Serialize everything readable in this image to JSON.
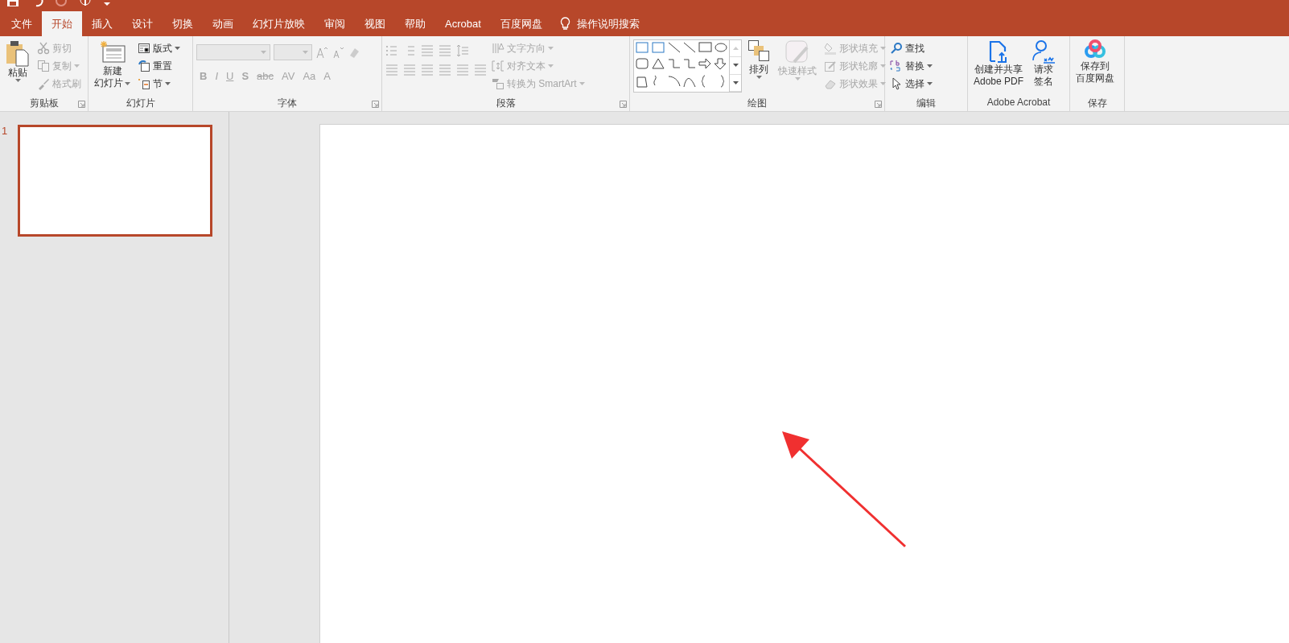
{
  "tabs": [
    {
      "label": "文件",
      "selected": false
    },
    {
      "label": "开始",
      "selected": true
    },
    {
      "label": "插入",
      "selected": false
    },
    {
      "label": "设计",
      "selected": false
    },
    {
      "label": "切换",
      "selected": false
    },
    {
      "label": "动画",
      "selected": false
    },
    {
      "label": "幻灯片放映",
      "selected": false
    },
    {
      "label": "审阅",
      "selected": false
    },
    {
      "label": "视图",
      "selected": false
    },
    {
      "label": "帮助",
      "selected": false
    },
    {
      "label": "Acrobat",
      "selected": false
    },
    {
      "label": "百度网盘",
      "selected": false
    }
  ],
  "tell_me": {
    "label": "操作说明搜索"
  },
  "ribbon": {
    "clipboard": {
      "label": "剪贴板",
      "paste": {
        "label": "粘贴"
      },
      "items": [
        {
          "label": "剪切",
          "disabled": true,
          "dropdown": false
        },
        {
          "label": "复制",
          "disabled": true,
          "dropdown": true
        },
        {
          "label": "格式刷",
          "disabled": true,
          "dropdown": false
        }
      ]
    },
    "slides": {
      "label": "幻灯片",
      "new_slide": {
        "line1": "新建",
        "line2": "幻灯片"
      },
      "items": [
        {
          "label": "版式",
          "disabled": false,
          "dropdown": true
        },
        {
          "label": "重置",
          "disabled": false,
          "dropdown": false
        },
        {
          "label": "节",
          "disabled": false,
          "dropdown": true
        }
      ]
    },
    "font": {
      "label": "字体",
      "format_buttons": [
        "B",
        "I",
        "U",
        "S",
        "abc",
        "AV",
        "Aa",
        "A"
      ]
    },
    "paragraph": {
      "label": "段落",
      "items": [
        {
          "label": "文字方向",
          "disabled": true,
          "dropdown": true
        },
        {
          "label": "对齐文本",
          "disabled": true,
          "dropdown": true
        },
        {
          "label": "转换为 SmartArt",
          "disabled": true,
          "dropdown": true
        }
      ]
    },
    "drawing": {
      "label": "绘图",
      "arrange": {
        "label": "排列",
        "disabled": false
      },
      "quick_styles": {
        "label": "快速样式",
        "disabled": true
      },
      "items": [
        {
          "label": "形状填充",
          "disabled": true,
          "dropdown": true
        },
        {
          "label": "形状轮廓",
          "disabled": true,
          "dropdown": true
        },
        {
          "label": "形状效果",
          "disabled": true,
          "dropdown": true
        }
      ]
    },
    "editing": {
      "label": "编辑",
      "items": [
        {
          "label": "查找",
          "disabled": false,
          "dropdown": false
        },
        {
          "label": "替换",
          "disabled": false,
          "dropdown": true
        },
        {
          "label": "选择",
          "disabled": false,
          "dropdown": true
        }
      ]
    },
    "acrobat": {
      "label": "Adobe Acrobat",
      "buttons": [
        {
          "line1": "创建并共享",
          "line2": "Adobe PDF"
        },
        {
          "line1": "请求",
          "line2": "签名"
        }
      ]
    },
    "save": {
      "label": "保存",
      "button": {
        "line1": "保存到",
        "line2": "百度网盘"
      }
    }
  },
  "slides_pane": {
    "thumbnails": [
      {
        "number": "1",
        "selected": true
      }
    ]
  }
}
